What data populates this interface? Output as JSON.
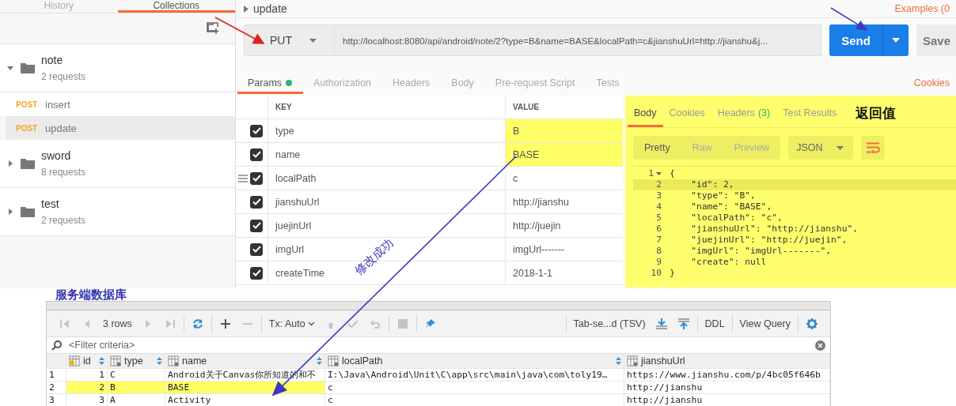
{
  "sidebar": {
    "tabs": [
      {
        "label": "History",
        "selected": false
      },
      {
        "label": "Collections",
        "selected": true
      }
    ],
    "collections": [
      {
        "name": "note",
        "count": "2 requests",
        "expanded": true,
        "requests": [
          {
            "method": "POST",
            "name": "insert",
            "selected": false
          },
          {
            "method": "POST",
            "name": "update",
            "selected": true
          }
        ]
      },
      {
        "name": "sword",
        "count": "8 requests",
        "expanded": false
      },
      {
        "name": "test",
        "count": "2 requests",
        "expanded": false
      }
    ]
  },
  "request": {
    "title": "update",
    "examples": "Examples (0",
    "method": "PUT",
    "url": "http://localhost:8080/api/android/note/2?type=B&name=BASE&localPath=c&jianshuUrl=http://jianshu&j...",
    "send": "Send",
    "save": "Save",
    "tabs": [
      {
        "label": "Params",
        "selected": true,
        "indicator": true
      },
      {
        "label": "Authorization",
        "selected": false,
        "indicator": false
      },
      {
        "label": "Headers",
        "selected": false,
        "indicator": false
      },
      {
        "label": "Body",
        "selected": false,
        "indicator": false
      },
      {
        "label": "Pre-request Script",
        "selected": false,
        "indicator": false
      },
      {
        "label": "Tests",
        "selected": false,
        "indicator": false
      }
    ],
    "cookies": "Cookies",
    "params": {
      "columns": [
        "KEY",
        "VALUE"
      ],
      "rows": [
        {
          "key": "type",
          "value": "B",
          "checked": true,
          "highlighted": true,
          "hovered": false
        },
        {
          "key": "name",
          "value": "BASE",
          "checked": true,
          "highlighted": true,
          "hovered": false
        },
        {
          "key": "localPath",
          "value": "c",
          "checked": true,
          "highlighted": false,
          "hovered": true
        },
        {
          "key": "jianshuUrl",
          "value": "http://jianshu",
          "checked": true,
          "highlighted": false,
          "hovered": false
        },
        {
          "key": "juejinUrl",
          "value": "http://juejin",
          "checked": true,
          "highlighted": false,
          "hovered": false
        },
        {
          "key": "imgUrl",
          "value": "imgUrl-------",
          "checked": true,
          "highlighted": false,
          "hovered": false
        },
        {
          "key": "createTime",
          "value": "2018-1-1",
          "checked": true,
          "highlighted": false,
          "hovered": false
        }
      ]
    }
  },
  "response": {
    "tabs": [
      {
        "label": "Body",
        "selected": true
      },
      {
        "label": "Cookies",
        "selected": false
      },
      {
        "label": "Headers",
        "count": "(3)",
        "selected": false
      },
      {
        "label": "Test Results",
        "selected": false
      }
    ],
    "annotation": "返回值",
    "views": [
      {
        "label": "Pretty",
        "selected": true
      },
      {
        "label": "Raw",
        "selected": false
      },
      {
        "label": "Preview",
        "selected": false
      }
    ],
    "format": "JSON",
    "code": [
      {
        "number": "1",
        "text": "{",
        "foldable": true,
        "selected": false
      },
      {
        "number": "2",
        "text": "    \"id\": 2,",
        "foldable": false,
        "selected": true
      },
      {
        "number": "3",
        "text": "    \"type\": \"B\",",
        "foldable": false,
        "selected": false
      },
      {
        "number": "4",
        "text": "    \"name\": \"BASE\",",
        "foldable": false,
        "selected": false
      },
      {
        "number": "5",
        "text": "    \"localPath\": \"c\",",
        "foldable": false,
        "selected": false
      },
      {
        "number": "6",
        "text": "    \"jianshuUrl\": \"http://jianshu\",",
        "foldable": false,
        "selected": false
      },
      {
        "number": "7",
        "text": "    \"juejinUrl\": \"http://juejin\",",
        "foldable": false,
        "selected": false
      },
      {
        "number": "8",
        "text": "    \"imgUrl\": \"imgUrl-------\",",
        "foldable": false,
        "selected": false
      },
      {
        "number": "9",
        "text": "    \"create\": null",
        "foldable": false,
        "selected": false
      },
      {
        "number": "10",
        "text": "}",
        "foldable": false,
        "selected": false
      }
    ]
  },
  "annotation": {
    "arrow_label": "修改成功"
  },
  "database": {
    "label": "服务端数据库",
    "toolbar": {
      "left_groups": [
        [
          {
            "kind": "first",
            "disabled": true
          },
          {
            "kind": "prev",
            "disabled": true
          },
          {
            "kind": "label",
            "text": "3 rows"
          },
          {
            "kind": "next",
            "disabled": true
          },
          {
            "kind": "last",
            "disabled": true
          }
        ],
        [
          {
            "kind": "refresh",
            "disabled": false
          }
        ],
        [
          {
            "kind": "add",
            "disabled": false
          },
          {
            "kind": "remove",
            "disabled": true
          }
        ],
        [
          {
            "kind": "dropdown",
            "text": "Tx: Auto"
          },
          {
            "kind": "commit",
            "disabled": true
          },
          {
            "kind": "check",
            "disabled": true
          },
          {
            "kind": "undo",
            "disabled": true
          }
        ],
        [
          {
            "kind": "stop",
            "disabled": true
          }
        ],
        [
          {
            "kind": "pin",
            "disabled": false
          }
        ]
      ],
      "right_groups": [
        [
          {
            "kind": "button",
            "text": "Tab-se...d (TSV)"
          },
          {
            "kind": "download",
            "disabled": false
          },
          {
            "kind": "upload",
            "disabled": false
          }
        ],
        [
          {
            "kind": "button",
            "text": "DDL"
          }
        ],
        [
          {
            "kind": "button",
            "text": "View Query"
          }
        ],
        [
          {
            "kind": "gear",
            "disabled": false
          }
        ]
      ]
    },
    "filter": {
      "placeholder": "<Filter criteria>"
    },
    "columns": [
      {
        "name": "id",
        "primary_key": true,
        "sortable": true
      },
      {
        "name": "type",
        "primary_key": false,
        "sortable": true
      },
      {
        "name": "name",
        "primary_key": false,
        "sortable": true
      },
      {
        "name": "localPath",
        "primary_key": false,
        "sortable": true
      },
      {
        "name": "jianshuUrl",
        "primary_key": false,
        "sortable": false
      }
    ],
    "rows": [
      {
        "number": "1",
        "cells": [
          "1",
          "C",
          "Android关于Canvas你所知道的和不",
          "I:\\Java\\Android\\Unit\\C\\app\\src\\main\\java\\com\\toly19…",
          "https://www.jianshu.com/p/4bc05f646b"
        ],
        "highlighted": false
      },
      {
        "number": "2",
        "cells": [
          "2",
          "B",
          "BASE",
          "c",
          "http://jianshu"
        ],
        "highlighted": true
      },
      {
        "number": "3",
        "cells": [
          "3",
          "A",
          "Activity",
          "c",
          "http://jianshu"
        ],
        "highlighted": false
      }
    ]
  }
}
